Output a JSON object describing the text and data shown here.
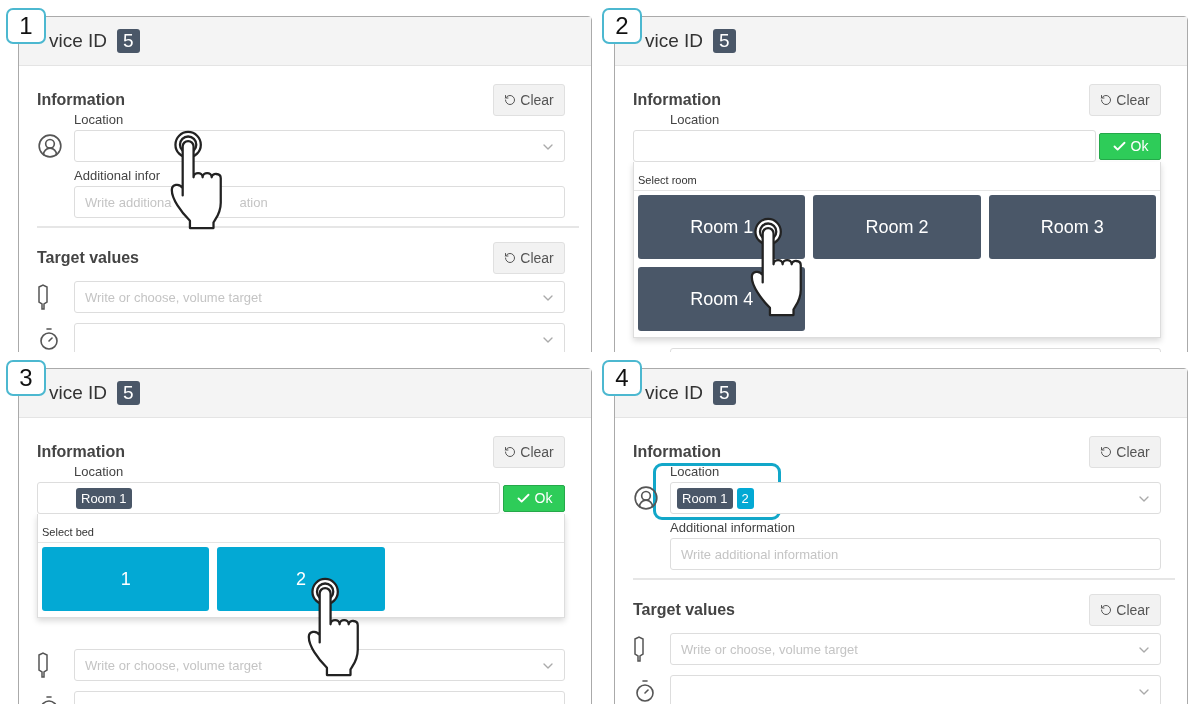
{
  "panels": [
    {
      "step": "1",
      "header": {
        "title": "vice ID",
        "badge": "5"
      },
      "information": {
        "title": "Information",
        "clear": "Clear",
        "location_label": "Location",
        "location": {
          "kind": "select",
          "tapped": true
        },
        "additional": {
          "label": "Additional infor",
          "placeholder_parts": [
            "Write additiona",
            "ation"
          ]
        }
      },
      "target_values": {
        "title": "Target values",
        "clear": "Clear",
        "volume_placeholder": "Write or choose, volume target"
      }
    },
    {
      "step": "2",
      "header": {
        "title": "vice ID",
        "badge": "5"
      },
      "information": {
        "title": "Information",
        "clear": "Clear",
        "location_label": "Location",
        "location": {
          "kind": "picker",
          "ok": "Ok"
        },
        "dropdown": {
          "kind": "room",
          "title": "Select room",
          "options": [
            {
              "label": "Room 1",
              "tapped": true
            },
            {
              "label": "Room 2",
              "tapped": false
            },
            {
              "label": "Room 3",
              "tapped": false
            },
            {
              "label": "Room 4",
              "tapped": false
            }
          ]
        }
      }
    },
    {
      "step": "3",
      "header": {
        "title": "vice ID",
        "badge": "5"
      },
      "information": {
        "title": "Information",
        "clear": "Clear",
        "location_label": "Location",
        "location": {
          "kind": "picker",
          "ok": "Ok",
          "chips": [
            {
              "label": "Room 1",
              "color": "#4a5768"
            }
          ]
        },
        "dropdown": {
          "kind": "bed",
          "title": "Select bed",
          "options": [
            {
              "label": "1",
              "tapped": false
            },
            {
              "label": "2",
              "tapped": true
            }
          ]
        }
      },
      "target_values": {
        "volume_placeholder": "Write or choose, volume target"
      }
    },
    {
      "step": "4",
      "header": {
        "title": "vice ID",
        "badge": "5"
      },
      "information": {
        "title": "Information",
        "clear": "Clear",
        "location_label": "Location",
        "location": {
          "kind": "select",
          "highlighted": true,
          "chips": [
            {
              "label": "Room 1",
              "color": "#4a5768"
            },
            {
              "label": "2",
              "color": "#03a9d4"
            }
          ]
        },
        "additional": {
          "label": "Additional information",
          "placeholder_parts": [
            "Write additional information"
          ]
        }
      },
      "target_values": {
        "title": "Target values",
        "clear": "Clear",
        "volume_placeholder": "Write or choose, volume target"
      }
    }
  ]
}
